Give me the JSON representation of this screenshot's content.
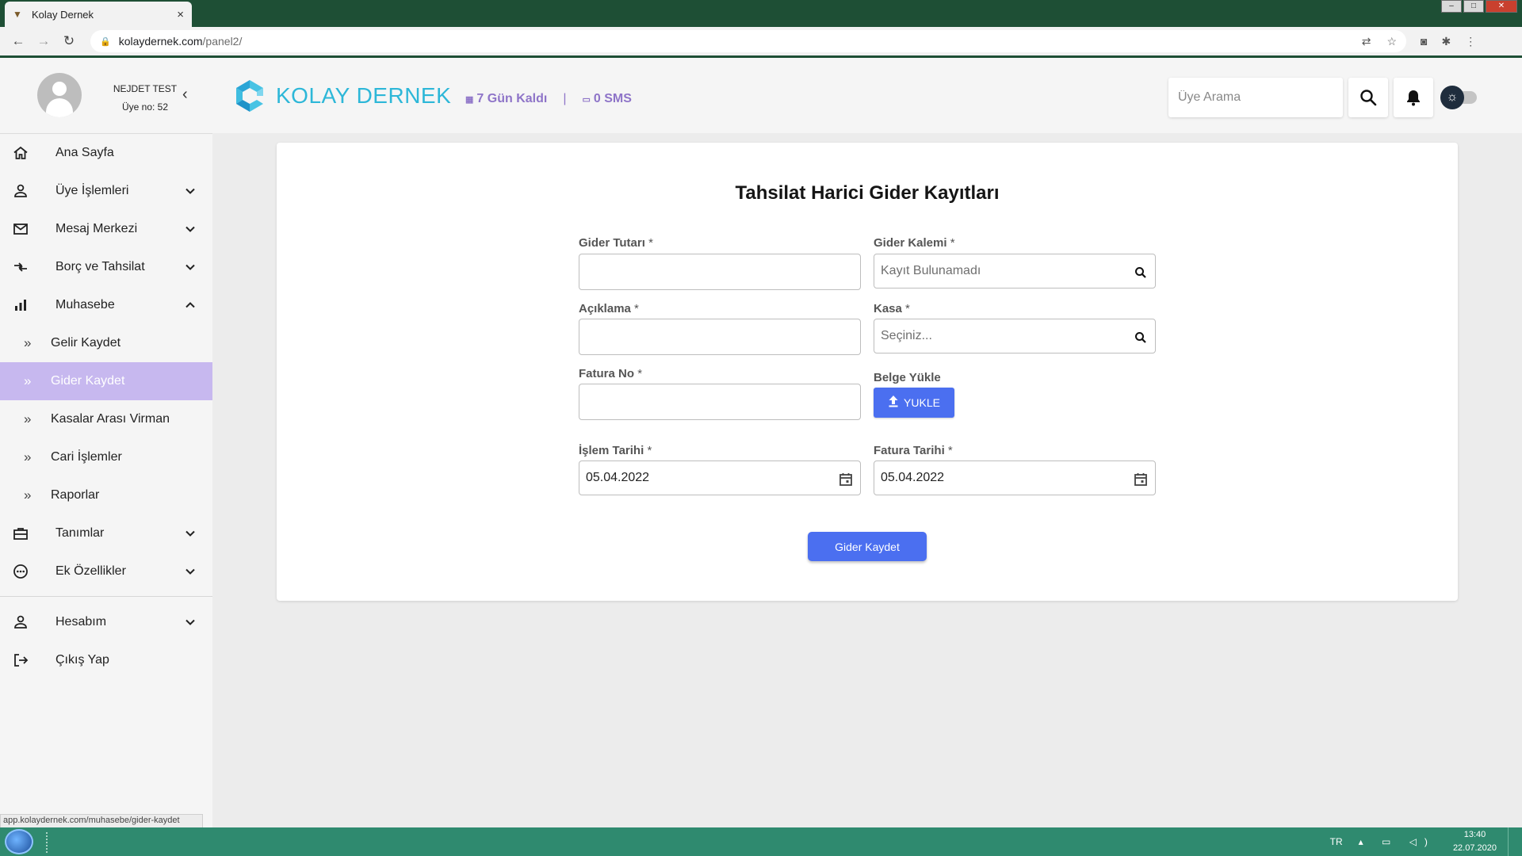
{
  "browser": {
    "tab_title": "Kolay Dernek",
    "tab_close": "×",
    "url_host": "kolaydernek.com",
    "url_path": "/panel2/",
    "status_url": "app.kolaydernek.com/muhasebe/gider-kaydet"
  },
  "header": {
    "user_name": "NEJDET TEST",
    "user_no": "Üye no: 52",
    "logo_text": "KOLAY DERNEK",
    "days_left": "7 Gün Kaldı",
    "separator": "|",
    "sms": "0 SMS",
    "search_placeholder": "Üye Arama"
  },
  "sidebar": {
    "items": [
      {
        "label": "Ana Sayfa",
        "icon": "home-icon"
      },
      {
        "label": "Üye İşlemleri",
        "icon": "person-icon"
      },
      {
        "label": "Mesaj Merkezi",
        "icon": "mail-icon"
      },
      {
        "label": "Borç ve Tahsilat",
        "icon": "transfer-icon"
      },
      {
        "label": "Muhasebe",
        "icon": "bar-chart-icon",
        "expanded": true
      },
      {
        "label": "Tanımlar",
        "icon": "briefcase-icon"
      },
      {
        "label": "Ek Özellikler",
        "icon": "more-circle-icon"
      },
      {
        "label": "Hesabım",
        "icon": "person-icon"
      },
      {
        "label": "Çıkış Yap",
        "icon": "logout-icon"
      }
    ],
    "sub_items": [
      {
        "label": "Gelir Kaydet",
        "active": false
      },
      {
        "label": "Gider Kaydet",
        "active": true
      },
      {
        "label": "Kasalar Arası Virman",
        "active": false
      },
      {
        "label": "Cari İşlemler",
        "active": false
      },
      {
        "label": "Raporlar",
        "active": false
      }
    ]
  },
  "form": {
    "title": "Tahsilat Harici Gider Kayıtları",
    "amount_label": "Gider Tutarı",
    "amount_value": "",
    "category_label": "Gider Kalemi",
    "category_placeholder": "Kayıt Bulunamadı",
    "description_label": "Açıklama",
    "description_value": "",
    "cashbox_label": "Kasa",
    "cashbox_placeholder": "Seçiniz...",
    "invoice_no_label": "Fatura No",
    "invoice_no_value": "",
    "upload_label": "Belge Yükle",
    "upload_button": "YUKLE",
    "transaction_date_label": "İşlem Tarihi",
    "transaction_date_value": "05.04.2022",
    "invoice_date_label": "Fatura Tarihi",
    "invoice_date_value": "05.04.2022",
    "required_mark": "*",
    "submit_button": "Gider Kaydet"
  },
  "taskbar": {
    "lang": "TR",
    "time": "13:40",
    "date": "22.07.2020"
  },
  "colors": {
    "accent": "#4b6ff0",
    "active_menu": "#c7b8ef",
    "logo": "#2db7d8",
    "info_text": "#8e74c8"
  }
}
